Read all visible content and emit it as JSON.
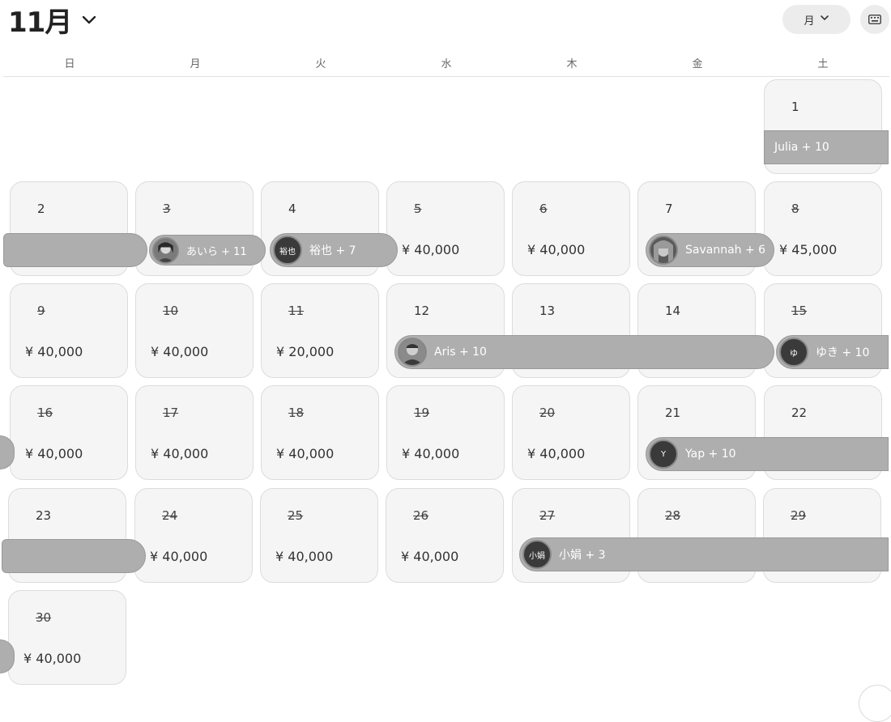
{
  "header": {
    "month_title": "11月",
    "view_selector_label": "月"
  },
  "weekdays": [
    "日",
    "月",
    "火",
    "水",
    "木",
    "金",
    "土"
  ],
  "days": [
    {
      "label": "1",
      "past": false,
      "price": ""
    },
    {
      "label": "2",
      "past": false,
      "price": ""
    },
    {
      "label": "3",
      "past": true,
      "price": ""
    },
    {
      "label": "4",
      "past": false,
      "price": ""
    },
    {
      "label": "5",
      "past": true,
      "price": "¥ 40,000"
    },
    {
      "label": "6",
      "past": true,
      "price": "¥ 40,000"
    },
    {
      "label": "7",
      "past": false,
      "price": ""
    },
    {
      "label": "8",
      "past": true,
      "price": "¥ 45,000"
    },
    {
      "label": "9",
      "past": true,
      "price": "¥ 40,000"
    },
    {
      "label": "10",
      "past": true,
      "price": "¥ 40,000"
    },
    {
      "label": "11",
      "past": true,
      "price": "¥ 20,000"
    },
    {
      "label": "12",
      "past": false,
      "price": ""
    },
    {
      "label": "13",
      "past": false,
      "price": ""
    },
    {
      "label": "14",
      "past": false,
      "price": ""
    },
    {
      "label": "15",
      "past": true,
      "price": ""
    },
    {
      "label": "16",
      "past": true,
      "price": "¥ 40,000"
    },
    {
      "label": "17",
      "past": true,
      "price": "¥ 40,000"
    },
    {
      "label": "18",
      "past": true,
      "price": "¥ 40,000"
    },
    {
      "label": "19",
      "past": true,
      "price": "¥ 40,000"
    },
    {
      "label": "20",
      "past": true,
      "price": "¥ 40,000"
    },
    {
      "label": "21",
      "past": false,
      "price": ""
    },
    {
      "label": "22",
      "past": false,
      "price": ""
    },
    {
      "label": "23",
      "past": false,
      "price": ""
    },
    {
      "label": "24",
      "past": true,
      "price": "¥ 40,000"
    },
    {
      "label": "25",
      "past": true,
      "price": "¥ 40,000"
    },
    {
      "label": "26",
      "past": true,
      "price": "¥ 40,000"
    },
    {
      "label": "27",
      "past": true,
      "price": ""
    },
    {
      "label": "28",
      "past": true,
      "price": ""
    },
    {
      "label": "29",
      "past": true,
      "price": ""
    },
    {
      "label": "30",
      "past": true,
      "price": "¥ 40,000"
    }
  ],
  "reservations": [
    {
      "label": "Julia + 10",
      "avatar": "none"
    },
    {
      "label": "",
      "avatar": "none"
    },
    {
      "label": "あいら + 11",
      "avatar": "photo"
    },
    {
      "label": "裕也 + 7",
      "avatar": "text",
      "avatar_text": "裕也"
    },
    {
      "label": "Savannah + 6",
      "avatar": "photo"
    },
    {
      "label": "Aris + 10",
      "avatar": "photo"
    },
    {
      "label": "ゆき + 10",
      "avatar": "text",
      "avatar_text": "ゆ"
    },
    {
      "label": "Yap + 10",
      "avatar": "text",
      "avatar_text": "Y"
    },
    {
      "label": "",
      "avatar": "none"
    },
    {
      "label": "小娟 + 3",
      "avatar": "text",
      "avatar_text": "小娟"
    }
  ]
}
